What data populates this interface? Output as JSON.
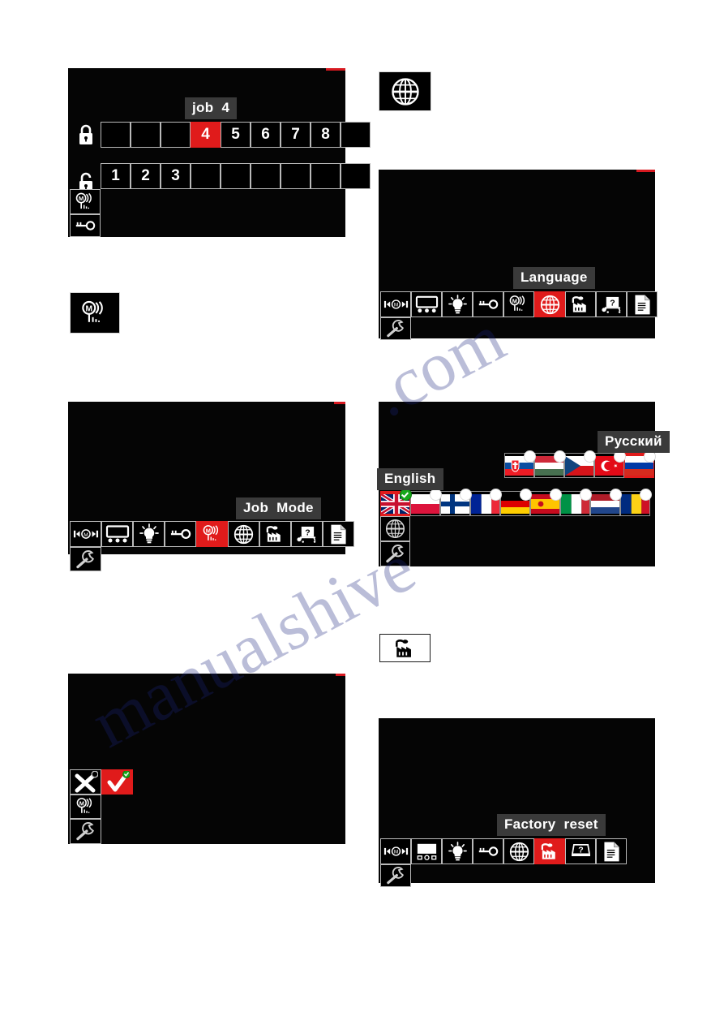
{
  "document": {
    "watermark_line1": "manualshive",
    "watermark_line2": ".com"
  },
  "panels": {
    "job_select": {
      "name": "job-select-screen",
      "tooltip": "job  4",
      "locked_row": {
        "icon": "lock-closed-icon",
        "slots": [
          "",
          "",
          "",
          "4",
          "5",
          "6",
          "7",
          "8",
          ""
        ],
        "selected_index": 3
      },
      "unlocked_row": {
        "icon": "lock-open-icon",
        "slots": [
          "1",
          "2",
          "3",
          "",
          "",
          "",
          "",
          "",
          ""
        ]
      },
      "side_icons": [
        "job-mode-icon",
        "key-icon"
      ]
    },
    "job_mode_icon_box": {
      "name": "job-mode-icon-standalone",
      "icon": "job-mode-icon"
    },
    "job_mode_menu": {
      "name": "job-mode-menu-screen",
      "tooltip": "Job  Mode",
      "toolbar": [
        {
          "icon": "memory-recall-icon",
          "selected": false
        },
        {
          "icon": "display-panel-icon",
          "selected": false
        },
        {
          "icon": "lightbulb-icon",
          "selected": false
        },
        {
          "icon": "key-icon",
          "selected": false
        },
        {
          "icon": "job-mode-icon",
          "selected": true
        },
        {
          "icon": "globe-icon",
          "selected": false
        },
        {
          "icon": "factory-reset-icon",
          "selected": false
        },
        {
          "icon": "help-cart-icon",
          "selected": false
        },
        {
          "icon": "document-icon",
          "selected": false
        }
      ],
      "second_row": [
        {
          "icon": "wrench-icon",
          "selected": false
        }
      ]
    },
    "job_mode_confirm": {
      "name": "job-mode-confirm-screen",
      "options": [
        {
          "icon": "cancel-x-icon",
          "selected": false,
          "badge": "none"
        },
        {
          "icon": "confirm-check-icon",
          "selected": true,
          "badge": "ok"
        }
      ],
      "side_icons": [
        "job-mode-icon",
        "wrench-icon"
      ]
    },
    "globe_icon_box": {
      "name": "globe-icon-standalone",
      "icon": "globe-icon"
    },
    "language_menu": {
      "name": "language-menu-screen",
      "tooltip": "Language",
      "toolbar": [
        {
          "icon": "memory-recall-icon",
          "selected": false
        },
        {
          "icon": "display-panel-icon",
          "selected": false
        },
        {
          "icon": "lightbulb-icon",
          "selected": false
        },
        {
          "icon": "key-icon",
          "selected": false
        },
        {
          "icon": "job-mode-icon",
          "selected": false
        },
        {
          "icon": "globe-icon",
          "selected": true
        },
        {
          "icon": "factory-reset-icon",
          "selected": false
        },
        {
          "icon": "help-cart-icon",
          "selected": false
        },
        {
          "icon": "document-icon",
          "selected": false
        }
      ],
      "second_row": [
        {
          "icon": "wrench-icon",
          "selected": false
        }
      ]
    },
    "language_list": {
      "name": "language-list-screen",
      "tooltip_left": "English",
      "tooltip_right": "Русский",
      "top_row": [
        {
          "flag": "slovakia-flag",
          "selected": false
        },
        {
          "flag": "hungary-flag",
          "selected": false
        },
        {
          "flag": "czechia-flag",
          "selected": false
        },
        {
          "flag": "turkey-flag",
          "selected": false
        },
        {
          "flag": "russia-flag",
          "selected": true
        }
      ],
      "bottom_row": [
        {
          "flag": "united-kingdom-flag",
          "selected": true,
          "badge": "ok"
        },
        {
          "flag": "poland-flag",
          "selected": false,
          "badge": "plain"
        },
        {
          "flag": "finland-flag",
          "selected": false,
          "badge": "plain"
        },
        {
          "flag": "france-flag",
          "selected": false,
          "badge": "plain"
        },
        {
          "flag": "germany-flag",
          "selected": false,
          "badge": "plain"
        },
        {
          "flag": "spain-flag",
          "selected": false,
          "badge": "plain"
        },
        {
          "flag": "italy-flag",
          "selected": false,
          "badge": "plain"
        },
        {
          "flag": "netherlands-flag",
          "selected": false,
          "badge": "plain"
        },
        {
          "flag": "romania-flag",
          "selected": false,
          "badge": "plain"
        }
      ],
      "side_icons": [
        "globe-icon",
        "wrench-icon"
      ]
    },
    "factory_icon_box": {
      "name": "factory-reset-icon-standalone",
      "icon": "factory-reset-icon"
    },
    "factory_reset_menu": {
      "name": "factory-reset-menu-screen",
      "tooltip": "Factory  reset",
      "toolbar": [
        {
          "icon": "memory-recall-icon",
          "selected": false
        },
        {
          "icon": "display-panel-icon",
          "selected": false
        },
        {
          "icon": "lightbulb-icon",
          "selected": false
        },
        {
          "icon": "key-icon",
          "selected": false
        },
        {
          "icon": "globe-icon",
          "selected": false
        },
        {
          "icon": "factory-reset-icon",
          "selected": true
        },
        {
          "icon": "help-cart-icon",
          "selected": false
        },
        {
          "icon": "document-icon",
          "selected": false
        }
      ],
      "second_row": [
        {
          "icon": "wrench-icon",
          "selected": false
        }
      ]
    }
  },
  "colors": {
    "accent_red": "#e01b1b",
    "screen_black": "#050505",
    "tooltip_gray": "#3a3a3a",
    "icon_white": "#ffffff",
    "badge_green": "#17a81a"
  }
}
